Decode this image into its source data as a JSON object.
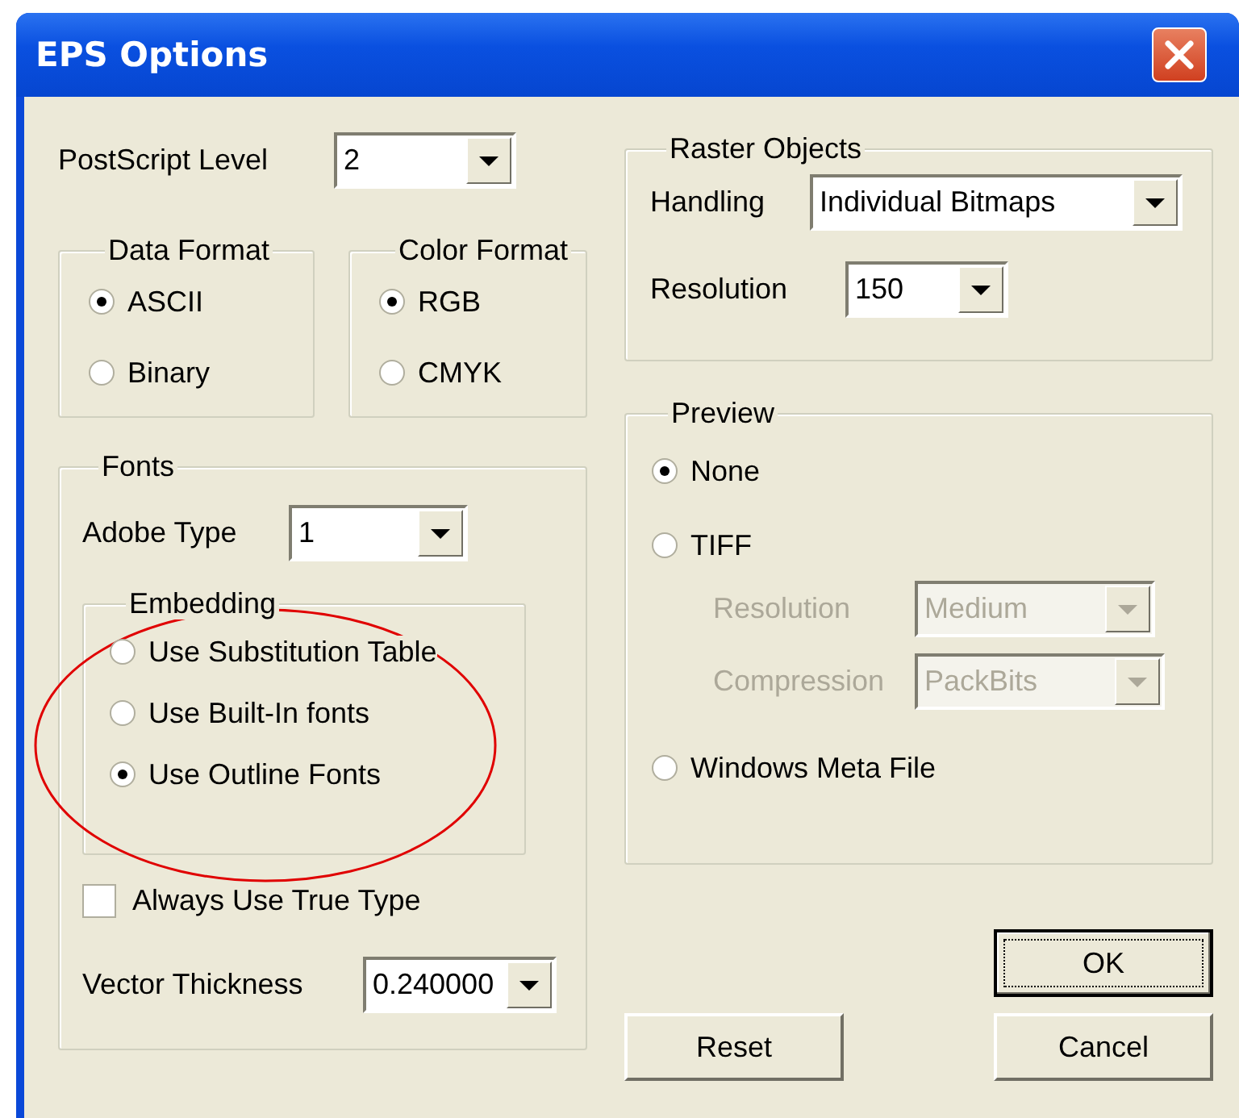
{
  "window": {
    "title": "EPS Options"
  },
  "postscript_level": {
    "label": "PostScript Level",
    "value": "2"
  },
  "data_format": {
    "title": "Data Format",
    "options": [
      {
        "label": "ASCII",
        "selected": true
      },
      {
        "label": "Binary",
        "selected": false
      }
    ]
  },
  "color_format": {
    "title": "Color Format",
    "options": [
      {
        "label": "RGB",
        "selected": true
      },
      {
        "label": "CMYK",
        "selected": false
      }
    ]
  },
  "fonts": {
    "title": "Fonts",
    "adobe_type": {
      "label": "Adobe Type",
      "value": "1"
    },
    "embedding": {
      "title": "Embedding",
      "highlighted": true,
      "options": [
        {
          "label": "Use Substitution Table",
          "selected": false
        },
        {
          "label": "Use Built-In fonts",
          "selected": false
        },
        {
          "label": "Use Outline Fonts",
          "selected": true
        }
      ]
    },
    "always_use_true_type": {
      "label": "Always Use True Type",
      "checked": false
    },
    "vector_thickness": {
      "label": "Vector Thickness",
      "value": "0.240000"
    }
  },
  "raster_objects": {
    "title": "Raster Objects",
    "handling": {
      "label": "Handling",
      "value": "Individual Bitmaps"
    },
    "resolution": {
      "label": "Resolution",
      "value": "150"
    }
  },
  "preview": {
    "title": "Preview",
    "items": [
      {
        "kind": "radio",
        "label": "None",
        "selected": true
      },
      {
        "kind": "radio",
        "label": "TIFF",
        "selected": false
      },
      {
        "kind": "combo",
        "label": "Resolution",
        "value": "Medium",
        "disabled": true
      },
      {
        "kind": "combo",
        "label": "Compression",
        "value": "PackBits",
        "disabled": true
      },
      {
        "kind": "radio",
        "label": "Windows Meta File",
        "selected": false
      }
    ]
  },
  "buttons": [
    {
      "label": "OK",
      "default": true
    },
    {
      "label": "Reset",
      "default": false
    },
    {
      "label": "Cancel",
      "default": false
    }
  ]
}
